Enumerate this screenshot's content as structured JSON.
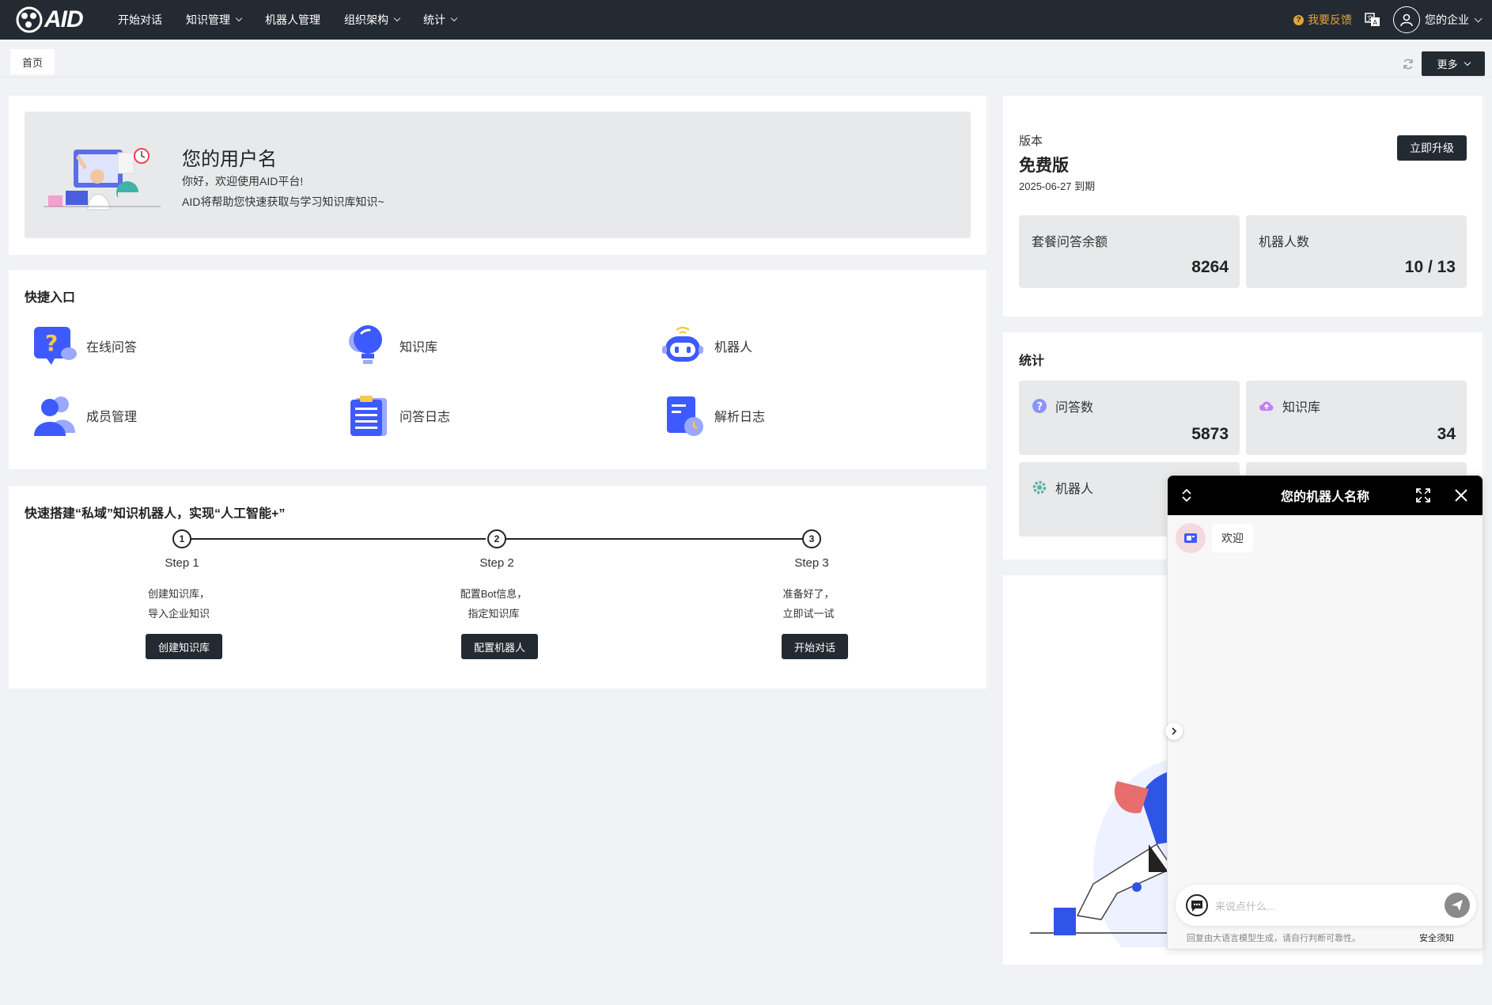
{
  "nav": {
    "logo_text": "AID",
    "items": [
      {
        "label": "开始对话",
        "has_dropdown": false
      },
      {
        "label": "知识管理",
        "has_dropdown": true
      },
      {
        "label": "机器人管理",
        "has_dropdown": false
      },
      {
        "label": "组织架构",
        "has_dropdown": true
      },
      {
        "label": "统计",
        "has_dropdown": true
      }
    ],
    "feedback_label": "我要反馈",
    "user_label": "您的企业"
  },
  "tabbar": {
    "home_tab": "首页",
    "more_label": "更多"
  },
  "welcome": {
    "username": "您的用户名",
    "greeting": "你好，欢迎使用AID平台!",
    "subtitle": "AID将帮助您快速获取与学习知识库知识~"
  },
  "quick": {
    "title": "快捷入口",
    "entries": [
      {
        "label": "在线问答",
        "icon": "question-bubble-icon"
      },
      {
        "label": "知识库",
        "icon": "lightbulb-icon"
      },
      {
        "label": "机器人",
        "icon": "robot-icon"
      },
      {
        "label": "成员管理",
        "icon": "members-icon"
      },
      {
        "label": "问答日志",
        "icon": "clipboard-list-icon"
      },
      {
        "label": "解析日志",
        "icon": "document-log-icon"
      }
    ]
  },
  "steps": {
    "title": "快速搭建“私域”知识机器人，实现“人工智能+”",
    "items": [
      {
        "num": "1",
        "title": "Step 1",
        "line1": "创建知识库，",
        "line2": "导入企业知识",
        "button": "创建知识库"
      },
      {
        "num": "2",
        "title": "Step 2",
        "line1": "配置Bot信息，",
        "line2": "指定知识库",
        "button": "配置机器人"
      },
      {
        "num": "3",
        "title": "Step 3",
        "line1": "准备好了，",
        "line2": "立即试一试",
        "button": "开始对话"
      }
    ]
  },
  "version": {
    "label": "版本",
    "plan": "免费版",
    "expire": "2025-06-27 到期",
    "upgrade_button": "立即升级",
    "quota_label": "套餐问答余额",
    "quota_value": "8264",
    "bots_label": "机器人数",
    "bots_value": "10 / 13"
  },
  "stats": {
    "title": "统计",
    "questions_label": "问答数",
    "questions_value": "5873",
    "kb_label": "知识库",
    "kb_value": "34",
    "robots_label": "机器人"
  },
  "chat": {
    "title": "您的机器人名称",
    "welcome_message": "欢迎",
    "input_placeholder": "来说点什么...",
    "disclaimer": "回复由大语言模型生成，请自行判断可靠性。",
    "safety_link": "安全须知"
  },
  "colors": {
    "dark": "#232a31",
    "accent_blue": "#3d5afe",
    "feedback": "#e6a23c",
    "panel_gray": "#e8e9ea"
  }
}
